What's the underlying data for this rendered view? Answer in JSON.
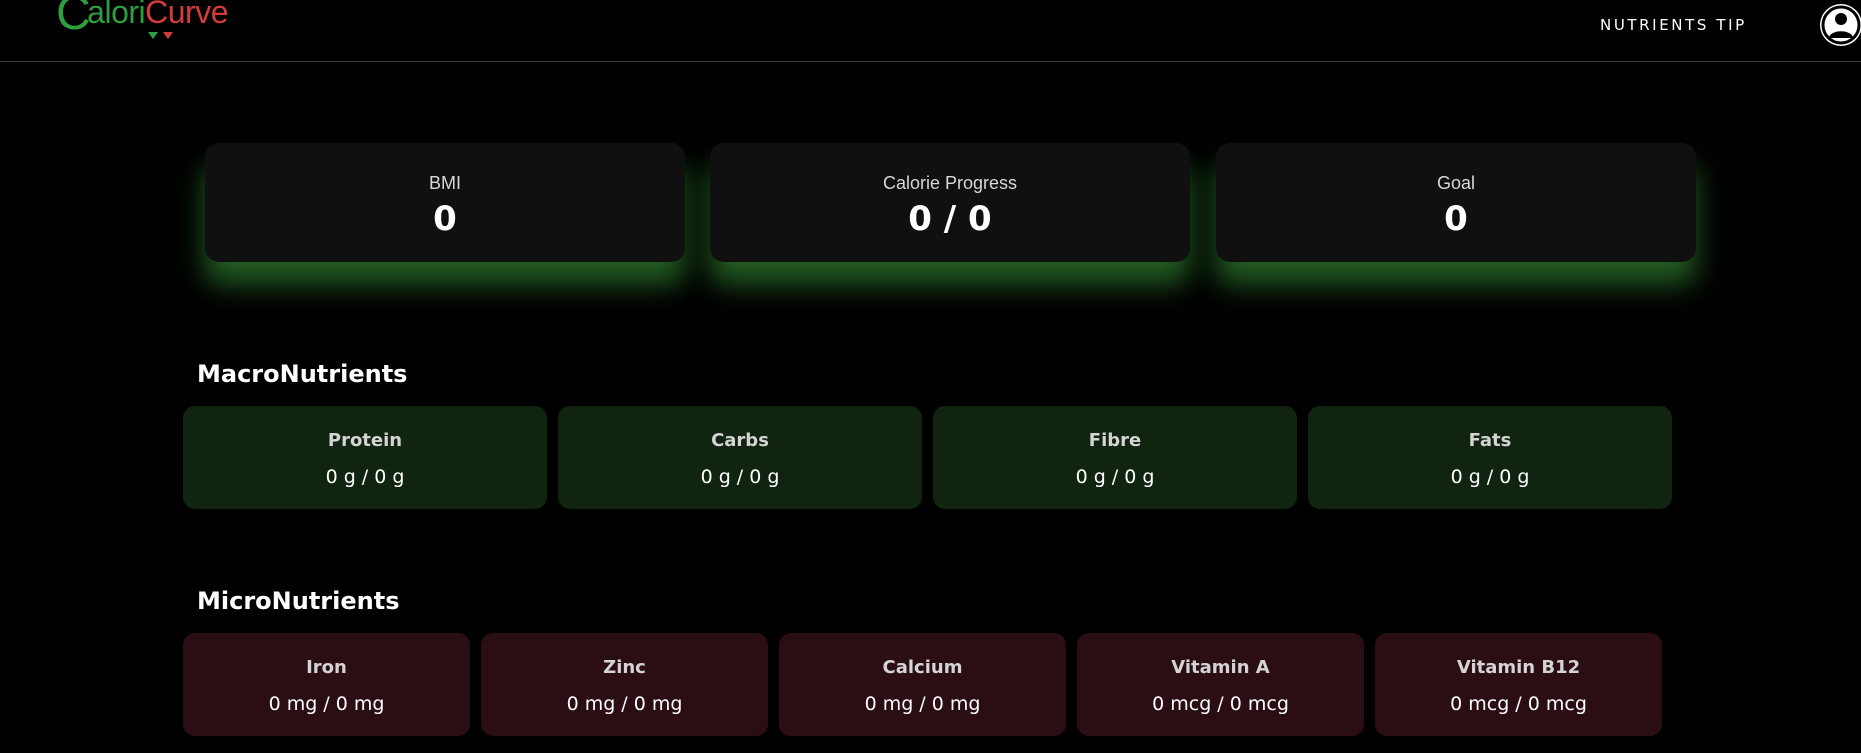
{
  "brand": {
    "logo_c": "C",
    "logo_alori": "alori",
    "logo_curve": "Curve",
    "colors": {
      "green": "#2e9e3e",
      "red": "#d43c3c"
    }
  },
  "nav": {
    "link_label": "NUTRIENTS TIP",
    "avatar_icon": "user-profile-icon"
  },
  "stats": [
    {
      "label": "BMI",
      "value": "0"
    },
    {
      "label": "Calorie Progress",
      "value": "0 / 0"
    },
    {
      "label": "Goal",
      "value": "0"
    }
  ],
  "macro": {
    "title": "MacroNutrients",
    "items": [
      {
        "name": "Protein",
        "value": "0 g / 0 g"
      },
      {
        "name": "Carbs",
        "value": "0 g / 0 g"
      },
      {
        "name": "Fibre",
        "value": "0 g / 0 g"
      },
      {
        "name": "Fats",
        "value": "0 g / 0 g"
      }
    ]
  },
  "micro": {
    "title": "MicroNutrients",
    "items": [
      {
        "name": "Iron",
        "value": "0 mg / 0 mg"
      },
      {
        "name": "Zinc",
        "value": "0 mg / 0 mg"
      },
      {
        "name": "Calcium",
        "value": "0 mg / 0 mg"
      },
      {
        "name": "Vitamin A",
        "value": "0 mcg / 0 mcg"
      },
      {
        "name": "Vitamin B12",
        "value": "0 mcg / 0 mcg"
      }
    ]
  },
  "theme": {
    "background": "#000000",
    "glow": "#40aa40",
    "macro_card": "#11240f",
    "micro_card": "#2a0e14"
  }
}
